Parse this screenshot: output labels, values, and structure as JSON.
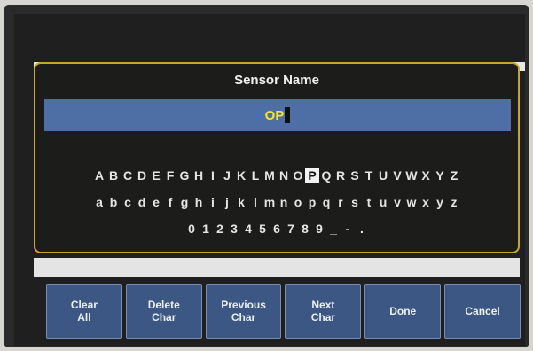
{
  "dialog": {
    "title": "Sensor Name",
    "entry_value": "OP"
  },
  "keyboard": {
    "uppercase": [
      "A",
      "B",
      "C",
      "D",
      "E",
      "F",
      "G",
      "H",
      "I",
      "J",
      "K",
      "L",
      "M",
      "N",
      "O",
      "P",
      "Q",
      "R",
      "S",
      "T",
      "U",
      "V",
      "W",
      "X",
      "Y",
      "Z"
    ],
    "lowercase": [
      "a",
      "b",
      "c",
      "d",
      "e",
      "f",
      "g",
      "h",
      "i",
      "j",
      "k",
      "l",
      "m",
      "n",
      "o",
      "p",
      "q",
      "r",
      "s",
      "t",
      "u",
      "v",
      "w",
      "x",
      "y",
      "z"
    ],
    "symbols": [
      "0",
      "1",
      "2",
      "3",
      "4",
      "5",
      "6",
      "7",
      "8",
      "9",
      "_",
      "-",
      "."
    ],
    "selected_key": "P"
  },
  "buttons": {
    "clear_all": "Clear\nAll",
    "delete_char": "Delete\nChar",
    "previous_char": "Previous\nChar",
    "next_char": "Next\nChar",
    "done": "Done",
    "cancel": "Cancel"
  },
  "colors": {
    "entry_background": "#4d6fa6",
    "entry_text": "#f5e62e",
    "dialog_border": "#c9a626",
    "button_background": "#3c5784"
  }
}
